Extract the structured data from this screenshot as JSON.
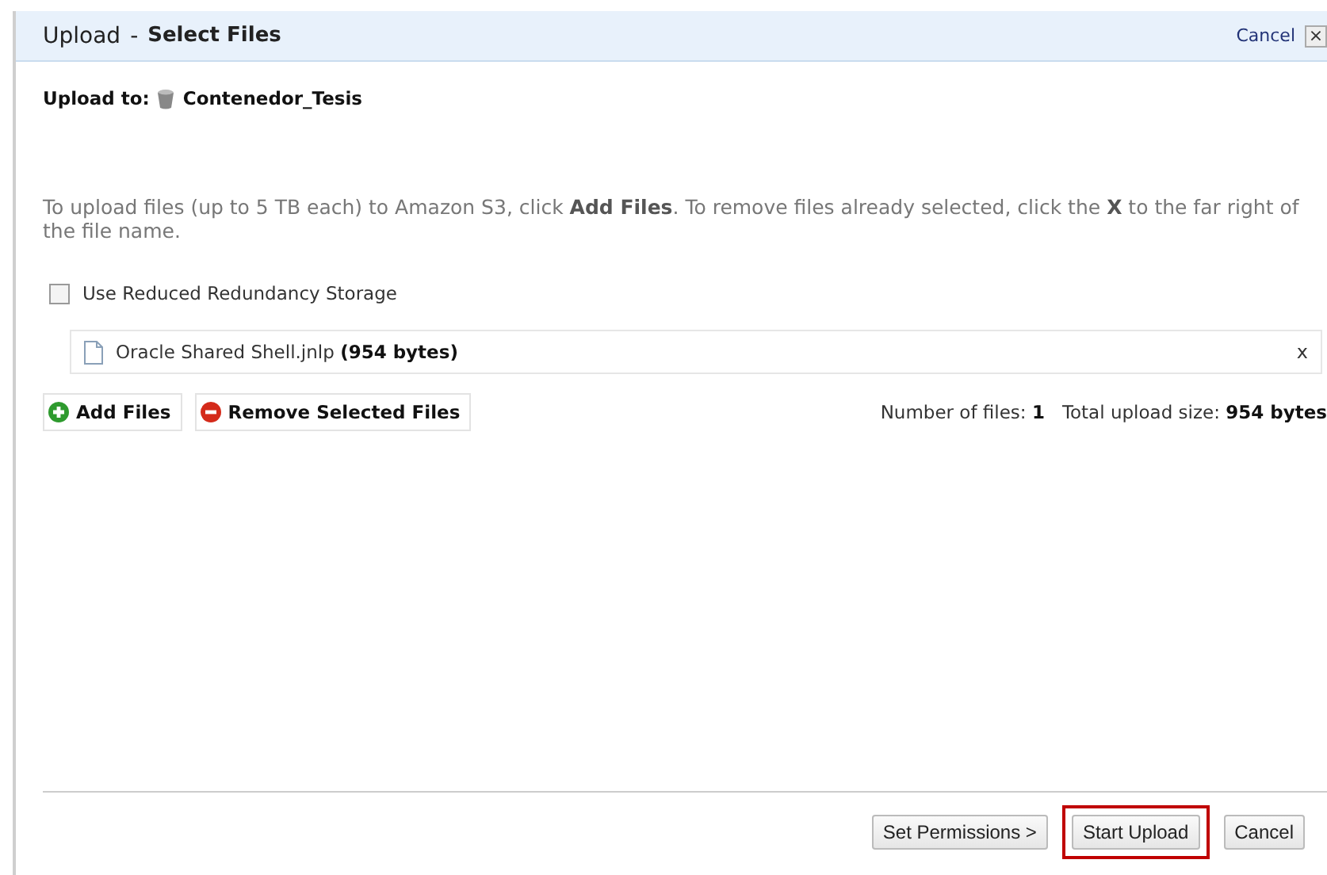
{
  "dialog": {
    "title": "Upload",
    "separator": "-",
    "subtitle": "Select Files",
    "close_link": "Cancel",
    "close_glyph": "×"
  },
  "upload_to": {
    "label": "Upload to:",
    "bucket": "Contenedor_Tesis"
  },
  "description": "To upload files (up to 5 TB each) to Amazon S3, click **Add Files**. To remove files already selected, click the **X** to the far right of the file name.",
  "reduced_redundancy": {
    "label": "Use Reduced Redundancy Storage",
    "checked": false
  },
  "files": [
    {
      "name": "Oracle Shared Shell.jnlp",
      "size": "(954 bytes)",
      "remove": "x"
    }
  ],
  "actions": [
    {
      "kind": "add",
      "label": "Add Files"
    },
    {
      "kind": "remove",
      "label": "Remove Selected Files"
    }
  ],
  "summary": {
    "count_label": "Number of files:",
    "count": "1",
    "size_label": "Total upload size:",
    "size": "954 bytes"
  },
  "buttons": [
    {
      "label": "Set Permissions >",
      "highlighted": false
    },
    {
      "label": "Start Upload",
      "highlighted": true
    },
    {
      "label": "Cancel",
      "highlighted": false
    }
  ]
}
